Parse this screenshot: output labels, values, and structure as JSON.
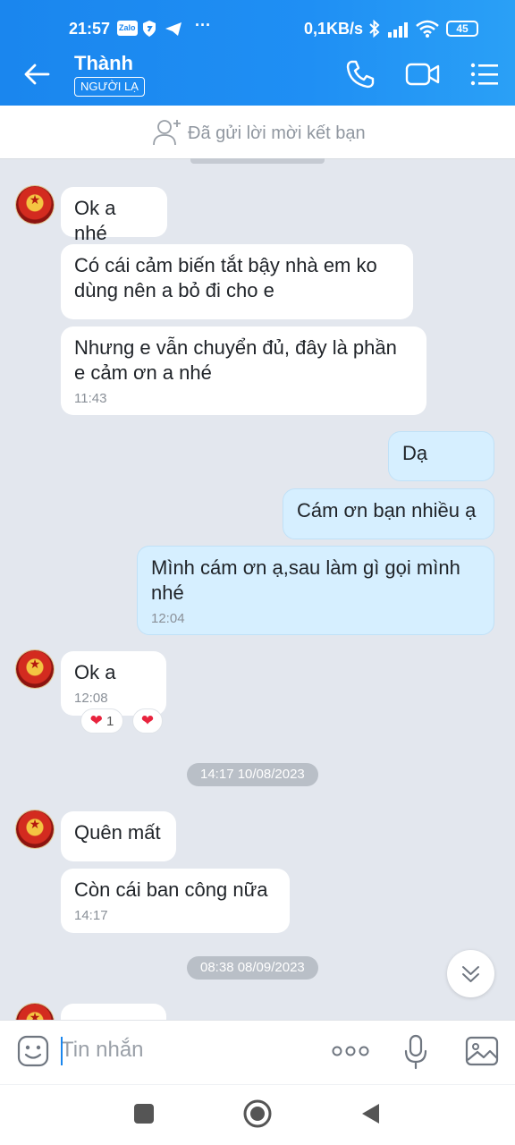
{
  "status_bar": {
    "time": "21:57",
    "app_badge": "Zalo",
    "net_speed": "0,1KB/s",
    "battery": "45"
  },
  "header": {
    "name": "Thành",
    "badge": "NGƯỜI LẠ"
  },
  "friend_request": {
    "text": "Đã gửi lời mời kết bạn"
  },
  "messages": [
    {
      "text": "Ok a nhé"
    },
    {
      "text_line1": "Có cái cảm biến tắt bậy nhà em ko",
      "text_line2": "dùng nên a bỏ đi cho e"
    },
    {
      "text_line1": "Nhưng e vẫn chuyển đủ, đây là phần",
      "text_line2": "e cảm ơn a nhé",
      "time": "11:43"
    },
    {
      "text": "Dạ"
    },
    {
      "text": "Cám ơn bạn nhiều ạ"
    },
    {
      "text_line1": "Mình cám ơn ạ,sau làm gì gọi mình",
      "text_line2": "nhé",
      "time": "12:04"
    },
    {
      "text": "Ok a",
      "time": "12:08",
      "reaction_count": "1"
    },
    {
      "text": "Quên mất"
    },
    {
      "text": "Còn cái ban công nữa",
      "time": "14:17"
    }
  ],
  "date_separators": [
    "14:17 10/08/2023",
    "08:38 08/09/2023"
  ],
  "composer": {
    "placeholder": "Tin nhắn"
  },
  "colors": {
    "header_blue": "#1f8ff4",
    "out_bubble": "#d6efff",
    "chat_bg": "#e3e7ee",
    "heart": "#e8233d"
  }
}
